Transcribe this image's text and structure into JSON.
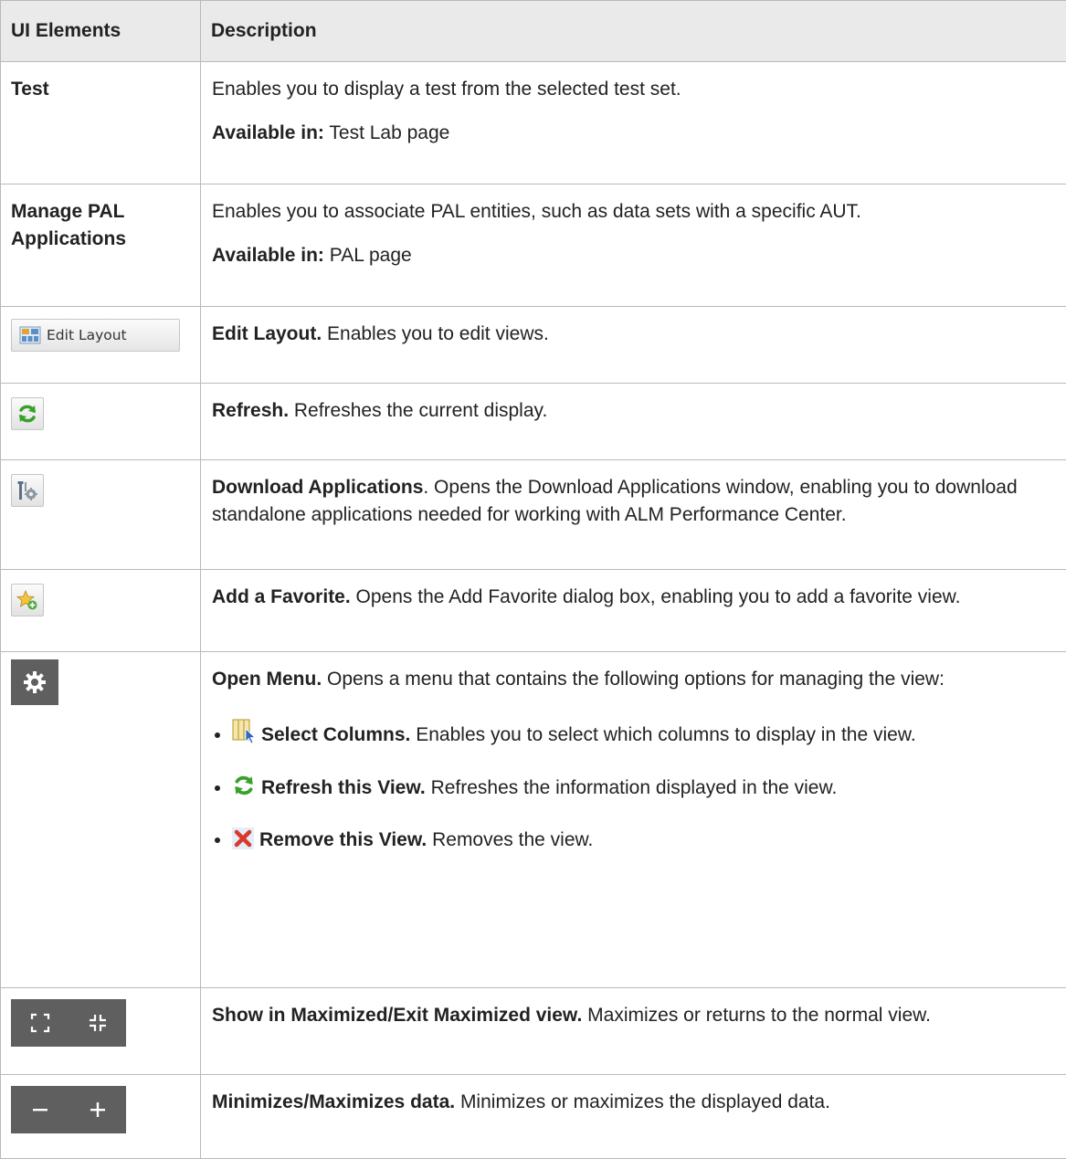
{
  "header": {
    "col1": "UI Elements",
    "col2": "Description"
  },
  "rows": {
    "test": {
      "element": "Test",
      "desc": "Enables you to display a test from the selected test set.",
      "avail_label": "Available in:",
      "avail_value": "Test Lab page"
    },
    "manage_pal": {
      "element": "Manage PAL Applications",
      "desc": "Enables you to associate PAL entities, such as data sets with a specific AUT.",
      "avail_label": "Available in:",
      "avail_value": "PAL page"
    },
    "edit_layout": {
      "button_label": "Edit Layout",
      "title": "Edit Layout.",
      "desc": "Enables you to edit views."
    },
    "refresh": {
      "title": "Refresh.",
      "desc": "Refreshes the current display."
    },
    "download": {
      "title": "Download Applications",
      "desc": ". Opens the Download Applications window, enabling you to download standalone applications needed for working with ALM Performance Center."
    },
    "favorite": {
      "title": "Add a Favorite.",
      "desc": "Opens the Add Favorite dialog box, enabling you to add a favorite view."
    },
    "open_menu": {
      "title": "Open Menu.",
      "desc": "Opens a menu that contains the following options for managing the view:",
      "options": [
        {
          "title": "Select Columns.",
          "desc": "Enables you to select which columns to display in the view."
        },
        {
          "title": "Refresh this View.",
          "desc": "Refreshes the information displayed in the view."
        },
        {
          "title": "Remove this View.",
          "desc": "Removes the view."
        }
      ]
    },
    "maximize": {
      "title": "Show in Maximized/Exit Maximized view.",
      "desc": "Maximizes or returns to the normal view."
    },
    "minmax_data": {
      "title": "Minimizes/Maximizes data.",
      "desc": "Minimizes or maximizes the displayed data."
    }
  }
}
